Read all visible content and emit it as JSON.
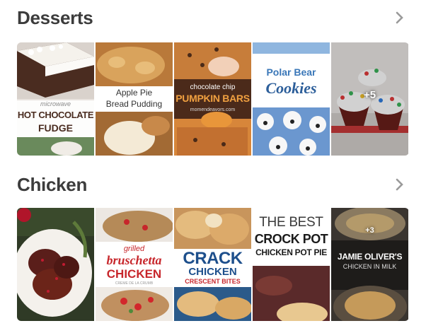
{
  "colors": {
    "heading": "#3c3c3c",
    "chevron": "#9a9a9a"
  },
  "sections": [
    {
      "title": "Desserts",
      "more_count": "+5",
      "tiles": [
        {
          "line1": "microwave",
          "line2": "HOT CHOCOLATE",
          "line3": "FUDGE"
        },
        {
          "line1": "Apple Pie",
          "line2": "Bread Pudding"
        },
        {
          "line1": "chocolate chip",
          "line2": "PUMPKIN BARS",
          "line3": "momendeavors.com"
        },
        {
          "line1": "Polar Bear",
          "line2": "Cookies"
        },
        {}
      ]
    },
    {
      "title": "Chicken",
      "more_count": "+3",
      "tiles": [
        {},
        {
          "line1": "grilled",
          "line2": "bruschetta",
          "line3": "CHICKEN",
          "line4": "CREME DE LA CRUMB"
        },
        {
          "line1": "CRACK",
          "line2": "CHICKEN",
          "line3": "CRESCENT BITES"
        },
        {
          "line1": "THE BEST",
          "line2": "CROCK POT",
          "line3": "CHICKEN POT PIE"
        },
        {
          "line1": "JAMIE OLIVER'S",
          "line2": "CHICKEN IN MILK"
        }
      ]
    }
  ]
}
